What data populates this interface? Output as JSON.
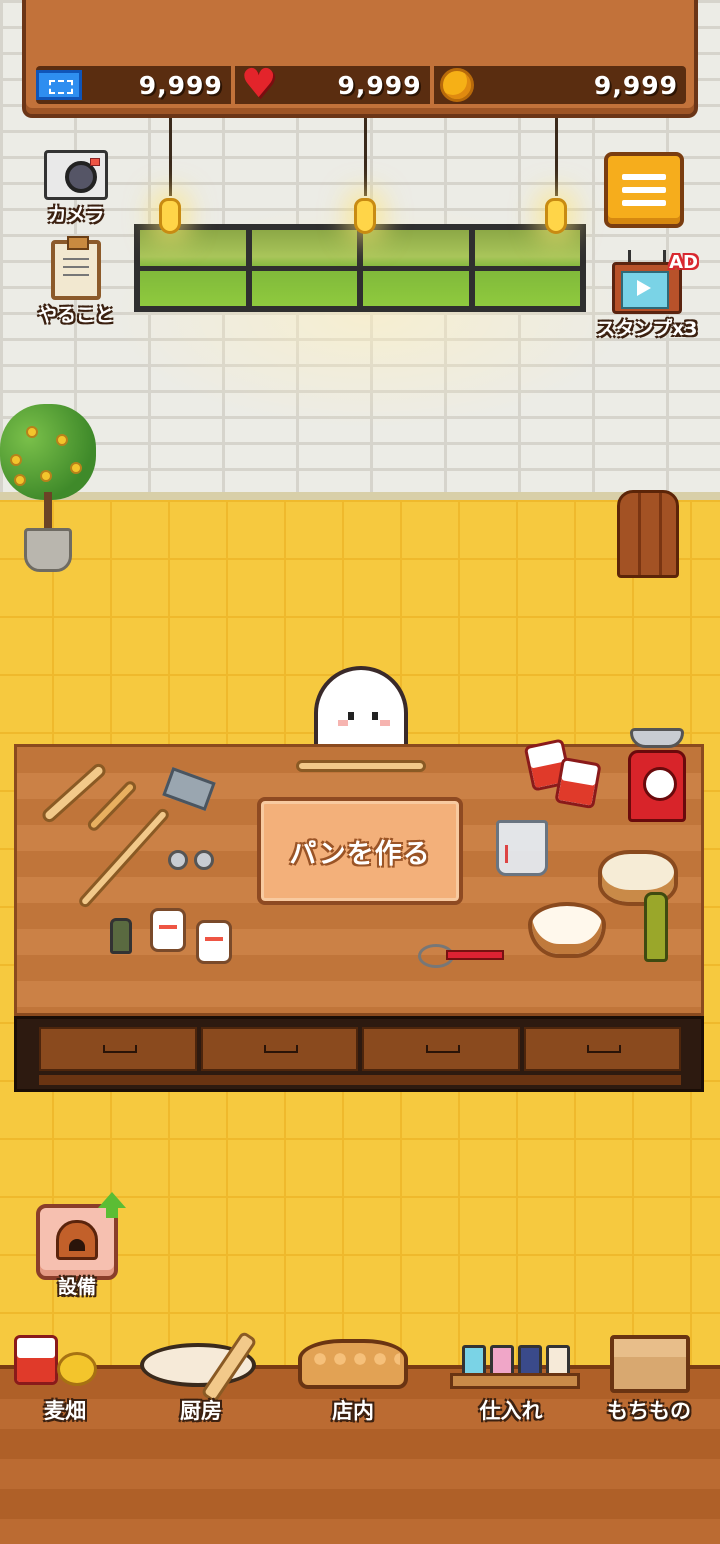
{
  "resources": {
    "tickets": "9,999",
    "hearts": "9,999",
    "coins": "9,999"
  },
  "side_buttons": {
    "camera_label": "カメラ",
    "todo_label": "やること"
  },
  "stamp": {
    "label": "スタンプx3",
    "badge": "AD"
  },
  "workbench": {
    "make_bread_label": "パンを作る"
  },
  "equipment": {
    "label": "設備"
  },
  "nav": {
    "items": [
      {
        "label": "麦畑"
      },
      {
        "label": "厨房"
      },
      {
        "label": "店内"
      },
      {
        "label": "仕入れ"
      },
      {
        "label": "もちもの"
      }
    ]
  },
  "colors": {
    "floor": "#f6c93f",
    "wood": "#c87a3c",
    "menu_button": "#f6ad1c",
    "heart": "#e3242b",
    "coin": "#f6b016",
    "ticket": "#2e8ef0"
  }
}
